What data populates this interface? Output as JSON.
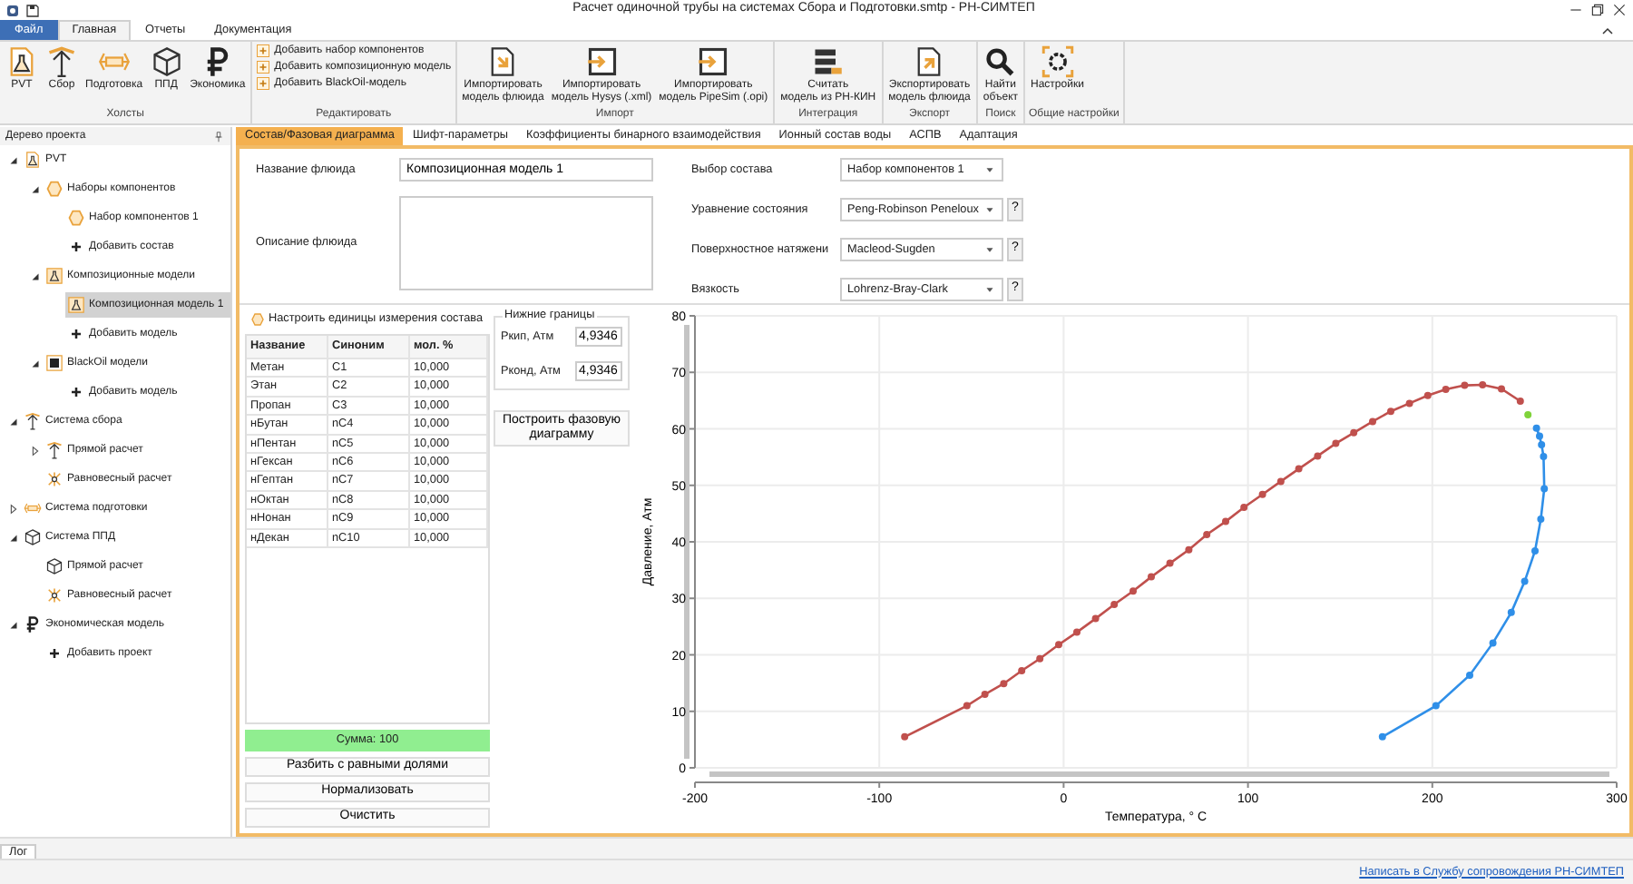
{
  "window": {
    "title": "Расчет одиночной трубы на системах Сбора и Подготовки.smtp - РН-СИМТЕП"
  },
  "menu_tabs": [
    {
      "label": "Файл",
      "kind": "file",
      "selected": false
    },
    {
      "label": "Главная",
      "kind": "tab",
      "selected": true
    },
    {
      "label": "Отчеты",
      "kind": "tab",
      "selected": false
    },
    {
      "label": "Документация",
      "kind": "tab",
      "selected": false
    }
  ],
  "ribbon": [
    {
      "label": "Холсты",
      "kind": "large",
      "buttons": [
        {
          "label": "PVT",
          "kind": "pvt"
        },
        {
          "label": "Сбор",
          "kind": "gather"
        },
        {
          "label": "Подготовка",
          "kind": "prep"
        },
        {
          "label": "ППД",
          "kind": "ppd"
        },
        {
          "label": "Экономика",
          "kind": "econ"
        }
      ]
    },
    {
      "label": "Редактировать",
      "kind": "stack",
      "buttons": [
        {
          "label": "Добавить набор компонентов",
          "kind": "plusbox"
        },
        {
          "label": "Добавить композиционную модель",
          "kind": "plusbox"
        },
        {
          "label": "Добавить BlackOil-модель",
          "kind": "plusbox"
        }
      ]
    },
    {
      "label": "Импорт",
      "kind": "large",
      "buttons": [
        {
          "label": "Импортировать\nмодель флюида",
          "kind": "importdoc"
        },
        {
          "label": "Импортировать\nмодель Hysys (.xml)",
          "kind": "importwin"
        },
        {
          "label": "Импортировать\nмодель PipeSim (.opi)",
          "kind": "importwin"
        }
      ]
    },
    {
      "label": "Интеграция",
      "kind": "large",
      "buttons": [
        {
          "label": "Считать\nмодель из РН-КИН",
          "kind": "db"
        }
      ]
    },
    {
      "label": "Экспорт",
      "kind": "large",
      "buttons": [
        {
          "label": "Экспортировать\nмодель флюида",
          "kind": "exportdoc"
        }
      ]
    },
    {
      "label": "Поиск",
      "kind": "large",
      "buttons": [
        {
          "label": "Найти\nобъект",
          "kind": "search"
        }
      ]
    },
    {
      "label": "Общие настройки",
      "kind": "large",
      "buttons": [
        {
          "label": "Настройки",
          "kind": "gear"
        }
      ]
    }
  ],
  "project_tree": {
    "title": "Дерево проекта",
    "nodes": [
      {
        "label": "PVT",
        "kind": "pvt",
        "expanded": true,
        "selected": false,
        "children": [
          {
            "label": "Наборы компонентов",
            "kind": "set",
            "expanded": true,
            "selected": false,
            "children": [
              {
                "label": "Набор компонентов 1",
                "kind": "set",
                "selected": false
              },
              {
                "label": "Добавить состав",
                "kind": "add",
                "selected": false
              }
            ]
          },
          {
            "label": "Композиционные модели",
            "kind": "model",
            "expanded": true,
            "selected": false,
            "children": [
              {
                "label": "Композиционная модель 1",
                "kind": "model",
                "selected": true
              },
              {
                "label": "Добавить модель",
                "kind": "add",
                "selected": false
              }
            ]
          },
          {
            "label": "BlackOil модели",
            "kind": "blackoil",
            "expanded": true,
            "selected": false,
            "children": [
              {
                "label": "Добавить модель",
                "kind": "add",
                "selected": false
              }
            ]
          }
        ]
      },
      {
        "label": "Система сбора",
        "kind": "gather",
        "expanded": true,
        "selected": false,
        "children": [
          {
            "label": "Прямой расчет",
            "kind": "gather",
            "expanded": false,
            "selected": false
          },
          {
            "label": "Равновесный расчет",
            "kind": "equil",
            "selected": false
          }
        ]
      },
      {
        "label": "Система подготовки",
        "kind": "prep",
        "expanded": false,
        "selected": false
      },
      {
        "label": "Система ППД",
        "kind": "ppd",
        "expanded": true,
        "selected": false,
        "children": [
          {
            "label": "Прямой расчет",
            "kind": "ppd",
            "selected": false
          },
          {
            "label": "Равновесный расчет",
            "kind": "equil",
            "selected": false
          }
        ]
      },
      {
        "label": "Экономическая модель",
        "kind": "econ",
        "expanded": true,
        "selected": false,
        "children": [
          {
            "label": "Добавить проект",
            "kind": "add",
            "selected": false
          }
        ]
      }
    ]
  },
  "tabs": [
    {
      "label": "Состав/Фазовая диаграмма",
      "selected": true
    },
    {
      "label": "Шифт-параметры",
      "selected": false
    },
    {
      "label": "Коэффициенты бинарного взаимодействия",
      "selected": false
    },
    {
      "label": "Ионный состав воды",
      "selected": false
    },
    {
      "label": "АСПВ",
      "selected": false
    },
    {
      "label": "Адаптация",
      "selected": false
    }
  ],
  "fluid_name": {
    "label": "Название флюида",
    "value": "Композиционная модель 1"
  },
  "fluid_description": {
    "label": "Описание флюида"
  },
  "settings": [
    {
      "label": "Выбор состава",
      "value": "Набор компонентов 1"
    },
    {
      "label": "Уравнение состояния",
      "value": "Peng-Robinson Peneloux",
      "help": "?"
    },
    {
      "label": "Поверхностное натяжени",
      "value": "Macleod-Sugden",
      "help": "?"
    },
    {
      "label": "Вязкость",
      "value": "Lohrenz-Bray-Clark",
      "help": "?"
    }
  ],
  "units_button": "Настроить единицы измерения состава",
  "composition": {
    "columns": [
      "Название",
      "Синоним",
      "мол. %"
    ],
    "rows": [
      [
        "Метан",
        "C1",
        "10,000"
      ],
      [
        "Этан",
        "C2",
        "10,000"
      ],
      [
        "Пропан",
        "C3",
        "10,000"
      ],
      [
        "нБутан",
        "nC4",
        "10,000"
      ],
      [
        "нПентан",
        "nC5",
        "10,000"
      ],
      [
        "нГексан",
        "nC6",
        "10,000"
      ],
      [
        "нГептан",
        "nC7",
        "10,000"
      ],
      [
        "нОктан",
        "nC8",
        "10,000"
      ],
      [
        "нНонан",
        "nC9",
        "10,000"
      ],
      [
        "нДекан",
        "nC10",
        "10,000"
      ]
    ]
  },
  "sum": "Сумма: 100",
  "actions": [
    "Разбить с равными долями",
    "Нормализовать",
    "Очистить"
  ],
  "bounds": {
    "title": "Нижние границы",
    "fields": [
      {
        "label": "Ркип, Атм",
        "value": "4,9346"
      },
      {
        "label": "Рконд, Атм",
        "value": "4,9346"
      }
    ]
  },
  "build_button": "Построить фазовую\nдиаграмму",
  "chart_data": {
    "type": "line",
    "grid": true,
    "xlabel": "Температура, ° С",
    "ylabel": "Давление, Атм",
    "xlim": [
      -200,
      300
    ],
    "ylim": [
      0,
      80
    ],
    "xticks": [
      -200,
      -100,
      0,
      100,
      200,
      300
    ],
    "yticks": [
      0,
      10,
      20,
      30,
      40,
      50,
      60,
      70,
      80
    ],
    "series": [
      {
        "color": "#c0504d",
        "marker": "circle",
        "x": [
          -86.2,
          -52.5,
          -42.7,
          -32.5,
          -22.7,
          -12.9,
          -2.7,
          7.2,
          17.3,
          27.5,
          37.7,
          47.5,
          57.7,
          67.9,
          77.7,
          87.9,
          97.8,
          107.9,
          117.8,
          127.6,
          137.8,
          147.6,
          157.4,
          167.6,
          177.5,
          187.6,
          197.5,
          207.3,
          217.5,
          227.3,
          237.5,
          247.7
        ],
        "values": [
          5.5,
          11.0,
          13.0,
          14.9,
          17.2,
          19.3,
          21.8,
          24.0,
          26.4,
          28.9,
          31.3,
          33.8,
          36.2,
          38.6,
          41.3,
          43.6,
          46.1,
          48.4,
          50.7,
          52.9,
          55.2,
          57.4,
          59.3,
          61.3,
          63.1,
          64.5,
          65.9,
          67.0,
          67.7,
          67.8,
          67.1,
          64.9
        ]
      },
      {
        "color": "#7fd33a",
        "marker": "circle",
        "x": [
          251.9
        ],
        "values": [
          62.5
        ]
      },
      {
        "color": "#2f8fe8",
        "marker": "circle",
        "x": [
          256.5,
          258.2,
          259.3,
          260.3,
          260.7,
          258.9,
          255.7,
          250.1,
          242.8,
          232.9,
          220.3,
          202.0,
          172.9
        ],
        "values": [
          60.1,
          58.7,
          57.2,
          55.1,
          49.4,
          44.0,
          38.4,
          33.0,
          27.5,
          22.1,
          16.4,
          11.0,
          5.5
        ]
      }
    ]
  },
  "log_tab": "Лог",
  "status_link": "Написать в Службу сопровождения РН-СИМТЕП"
}
